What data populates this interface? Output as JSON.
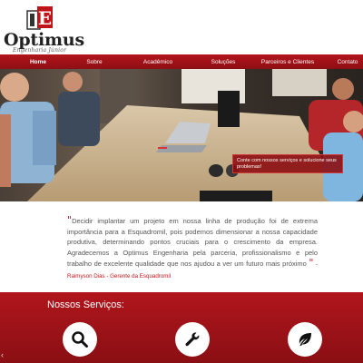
{
  "brand": {
    "name": "Optimus",
    "tagline": "Engenharia Júnior",
    "mark": "E"
  },
  "nav": {
    "items": [
      {
        "label": "Home",
        "active": true
      },
      {
        "label": "Sobre",
        "active": false
      },
      {
        "label": "Acadêmico",
        "active": false
      },
      {
        "label": "Soluções",
        "active": false
      },
      {
        "label": "Parceiros e Clientes",
        "active": false
      },
      {
        "label": "Contato",
        "active": false
      }
    ]
  },
  "hero": {
    "cta": "Conte com nossos serviços e solucione seus problemas!"
  },
  "testimonial": {
    "text": "Decidir implantar um projeto em nossa linha de produção foi de extrema importância para a Esquadromil, pois podemos dimensionar a nossa capacidade produtiva, determinando pontos cruciais para o crescimento da empresa. Agradecemos a Optimus Engenharia pela parceria, profissionalismo e pelo trabalho de excelente qualidade que nos ajudou a ver um futuro mais próximo",
    "author": "- Raimyson Dias - Gerente da Esquadromil"
  },
  "services": {
    "title": "Nossos Serviços:",
    "items": [
      {
        "icon": "search-icon"
      },
      {
        "icon": "wrench-icon"
      },
      {
        "icon": "leaf-icon"
      }
    ]
  },
  "colors": {
    "brand_red": "#b3141b",
    "dark_red": "#8a0f14",
    "text_gray": "#555555"
  }
}
